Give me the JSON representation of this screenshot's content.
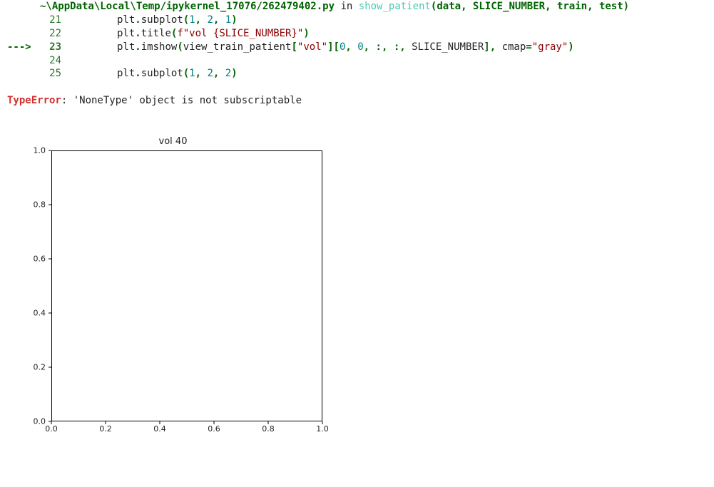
{
  "traceback": {
    "path": "~\\AppData\\Local\\Temp/ipykernel_17076/262479402.py",
    "in_word": "in",
    "func": "show_patient",
    "args_open": "(",
    "arg1": "data",
    "comma": ", ",
    "arg2": "SLICE_NUMBER",
    "arg3": "train",
    "arg4": "test",
    "args_close": ")",
    "arrow": "--->",
    "lines": [
      {
        "no": "21",
        "tokens": [
          "plt",
          ".",
          "subplot",
          "(",
          "1",
          ", ",
          "2",
          ", ",
          "1",
          ")"
        ]
      },
      {
        "no": "22",
        "tokens": [
          "plt",
          ".",
          "title",
          "(",
          "f\"vol {SLICE_NUMBER}\"",
          ")"
        ]
      },
      {
        "no": "23",
        "is_target": true,
        "tokens": [
          "plt",
          ".",
          "imshow",
          "(",
          "view_train_patient",
          "[",
          "\"vol\"",
          "]",
          "[",
          "0",
          ", ",
          "0",
          ", :, :, ",
          "SLICE_NUMBER",
          "]",
          ", ",
          "cmap",
          "=",
          "\"gray\"",
          ")"
        ]
      },
      {
        "no": "24",
        "tokens": []
      },
      {
        "no": "25",
        "tokens": [
          "plt",
          ".",
          "subplot",
          "(",
          "1",
          ", ",
          "2",
          ", ",
          "2",
          ")"
        ]
      }
    ],
    "error_type": "TypeError",
    "error_msg": ": 'NoneType' object is not subscriptable"
  },
  "chart_data": {
    "type": "scatter",
    "title": "vol 40",
    "x": [],
    "y": [],
    "xlim": [
      0.0,
      1.0
    ],
    "ylim": [
      0.0,
      1.0
    ],
    "xticks": [
      "0.0",
      "0.2",
      "0.4",
      "0.6",
      "0.8",
      "1.0"
    ],
    "yticks": [
      "0.0",
      "0.2",
      "0.4",
      "0.6",
      "0.8",
      "1.0"
    ],
    "xlabel": "",
    "ylabel": "",
    "grid": false
  }
}
